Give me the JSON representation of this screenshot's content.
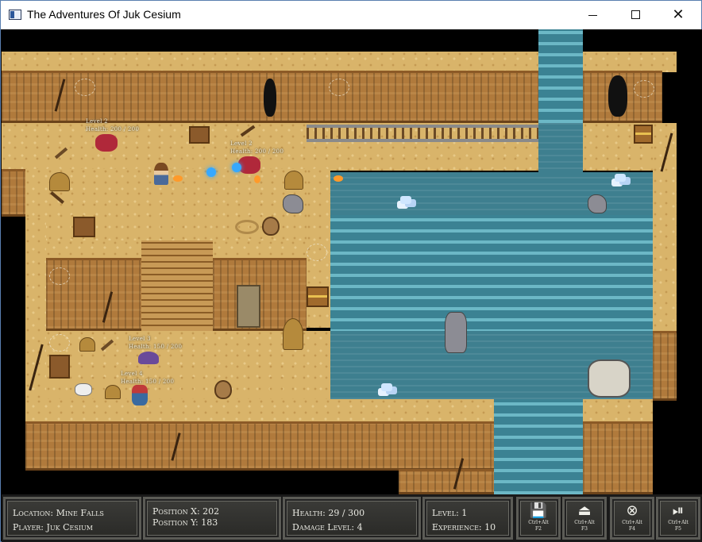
{
  "window": {
    "title": "The Adventures Of Juk Cesium",
    "minimize_label": "—",
    "maximize_label": "☐",
    "close_label": "✕"
  },
  "map": {
    "labels": {
      "enemy1_level": "Level 2",
      "enemy1_health": "Health: 200 / 200",
      "enemy2_level": "Level 2",
      "enemy2_health": "Health: 200 / 200",
      "bat_level": "Level 3",
      "bat_health": "Health: 150 / 200",
      "goblin_level": "Level 4",
      "goblin_health": "Health: 150 / 200"
    }
  },
  "hud": {
    "location": "Location: Mine Falls",
    "player": "Player: Juk Cesium",
    "position_x": "Position X: 202",
    "position_y": "Position Y: 183",
    "health": "Health: 29 / 300",
    "damage_level": "Damage Level: 4",
    "level": "Level: 1",
    "experience": "Experience: 10",
    "buttons": [
      {
        "icon": "save-icon",
        "glyph": "💾",
        "line1": "Ctrl+Alt",
        "line2": "F2"
      },
      {
        "icon": "load-icon",
        "glyph": "⏏",
        "line1": "Ctrl+Alt",
        "line2": "F3"
      },
      {
        "icon": "quit-icon",
        "glyph": "⊗",
        "line1": "Ctrl+Alt",
        "line2": "F4"
      },
      {
        "icon": "play-pause-icon",
        "glyph": "⏯",
        "line1": "Ctrl+Alt",
        "line2": "F5"
      }
    ]
  }
}
